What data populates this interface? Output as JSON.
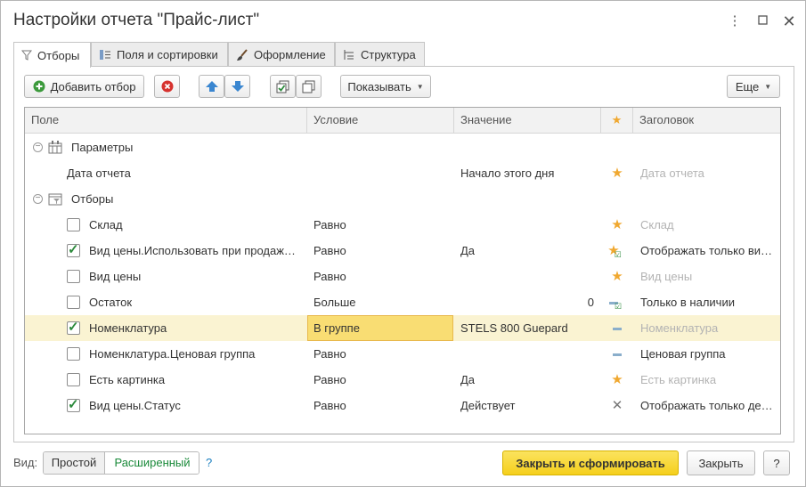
{
  "window": {
    "title": "Настройки отчета \"Прайс-лист\""
  },
  "tabs": [
    {
      "label": "Отборы",
      "icon": "filter-icon",
      "active": true
    },
    {
      "label": "Поля и сортировки",
      "icon": "fields-icon",
      "active": false
    },
    {
      "label": "Оформление",
      "icon": "brush-icon",
      "active": false
    },
    {
      "label": "Структура",
      "icon": "structure-icon",
      "active": false
    }
  ],
  "toolbar": {
    "add_filter": "Добавить отбор",
    "show": "Показывать",
    "more": "Еще"
  },
  "grid": {
    "columns": [
      "Поле",
      "Условие",
      "Значение",
      "★",
      "Заголовок"
    ],
    "groups": {
      "params": "Параметры",
      "filters": "Отборы"
    },
    "rows": [
      {
        "field": "Дата отчета",
        "condition": "",
        "value": "Начало этого дня",
        "mark": "star",
        "caption": "Дата отчета",
        "caption_muted": true
      },
      {
        "field": "Склад",
        "checked": false,
        "condition": "Равно",
        "value": "",
        "mark": "star",
        "caption": "Склад",
        "caption_muted": true
      },
      {
        "field": "Вид цены.Использовать при продаж…",
        "checked": true,
        "condition": "Равно",
        "value": "Да",
        "mark": "star-check",
        "caption": "Отображать только ви…",
        "caption_muted": false
      },
      {
        "field": "Вид цены",
        "checked": false,
        "condition": "Равно",
        "value": "",
        "mark": "star",
        "caption": "Вид цены",
        "caption_muted": true
      },
      {
        "field": "Остаток",
        "checked": false,
        "condition": "Больше",
        "value": "0",
        "mark": "dash-check",
        "caption": "Только в наличии",
        "caption_muted": false
      },
      {
        "field": "Номенклатура",
        "checked": true,
        "condition": "В группе",
        "value": "STELS 800 Guepard",
        "mark": "dash",
        "caption": "Номенклатура",
        "caption_muted": true,
        "selected": true
      },
      {
        "field": "Номенклатура.Ценовая группа",
        "checked": false,
        "condition": "Равно",
        "value": "",
        "mark": "dash",
        "caption": "Ценовая группа",
        "caption_muted": false
      },
      {
        "field": "Есть картинка",
        "checked": false,
        "condition": "Равно",
        "value": "Да",
        "mark": "star",
        "caption": "Есть картинка",
        "caption_muted": true
      },
      {
        "field": "Вид цены.Статус",
        "checked": true,
        "condition": "Равно",
        "value": "Действует",
        "mark": "cross",
        "caption": "Отображать только де…",
        "caption_muted": false
      }
    ]
  },
  "footer": {
    "view_label": "Вид:",
    "simple": "Простой",
    "advanced": "Расширенный",
    "help": "?",
    "close_generate": "Закрыть и сформировать",
    "close": "Закрыть",
    "help_btn": "?"
  },
  "colors": {
    "accent_yellow": "#f5cf1c",
    "selection": "#faf3d2",
    "star": "#f0a830",
    "check": "#2c8a3c"
  }
}
